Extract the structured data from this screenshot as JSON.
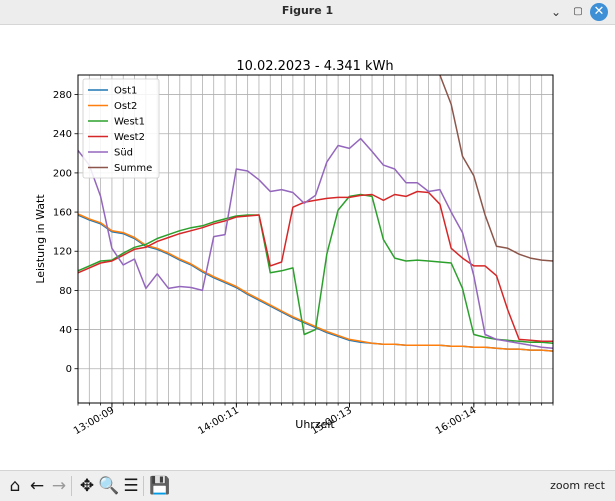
{
  "window": {
    "title": "Figure 1"
  },
  "icons": {
    "minimize": "minimize-icon",
    "maximize": "maximize-icon",
    "close": "close-icon"
  },
  "toolbar": {
    "buttons": [
      {
        "name": "home-icon",
        "glyph": "⌂",
        "enabled": true
      },
      {
        "name": "back-arrow-icon",
        "glyph": "←",
        "enabled": true
      },
      {
        "name": "forward-arrow-icon",
        "glyph": "→",
        "enabled": false
      },
      {
        "name": "pan-icon",
        "glyph": "✥",
        "enabled": true
      },
      {
        "name": "zoom-magnifier-icon",
        "glyph": "🔍",
        "enabled": true
      },
      {
        "name": "configure-subplots-icon",
        "glyph": "☰",
        "enabled": true
      },
      {
        "name": "save-icon",
        "glyph": "💾",
        "enabled": true
      }
    ],
    "mode_text": "zoom rect"
  },
  "chart_data": {
    "type": "line",
    "title": "10.02.2023  -  4.341 kWh",
    "xlabel": "Uhrzeit",
    "ylabel": "Leistung in Watt",
    "ylim": [
      -35,
      300
    ],
    "yticks": [
      0,
      40,
      80,
      120,
      160,
      200,
      240,
      280
    ],
    "x": [
      0,
      1,
      2,
      3,
      4,
      5,
      6,
      7,
      8,
      9,
      10,
      11,
      12,
      13,
      14,
      15,
      16,
      17,
      18,
      19,
      20,
      21,
      22,
      23,
      24,
      25,
      26,
      27,
      28,
      29,
      30,
      31,
      32,
      33,
      34,
      35,
      36,
      37,
      38,
      39,
      40,
      41,
      42
    ],
    "xlim": [
      0,
      42
    ],
    "xticks": [
      {
        "pos": 3,
        "label": "13:00:09"
      },
      {
        "pos": 14,
        "label": "14:00:11"
      },
      {
        "pos": 24,
        "label": "15:00:13"
      },
      {
        "pos": 35,
        "label": "16:00:14"
      }
    ],
    "grid": true,
    "legend": "top-left",
    "series": [
      {
        "name": "Ost1",
        "color": "#1f77b4",
        "values": [
          157,
          152,
          148,
          140,
          138,
          133,
          125,
          122,
          117,
          111,
          106,
          99,
          93,
          88,
          83,
          76,
          70,
          64,
          58,
          52,
          47,
          42,
          37,
          33,
          29,
          27,
          26,
          25,
          25,
          24,
          24,
          24,
          24,
          23,
          23,
          22,
          22,
          21,
          20,
          20,
          19,
          19,
          18
        ]
      },
      {
        "name": "Ost2",
        "color": "#ff7f0e",
        "values": [
          158,
          153,
          149,
          141,
          139,
          134,
          126,
          123,
          118,
          112,
          107,
          100,
          94,
          89,
          84,
          77,
          71,
          65,
          59,
          53,
          48,
          43,
          38,
          34,
          30,
          28,
          26,
          25,
          25,
          24,
          24,
          24,
          24,
          23,
          23,
          22,
          22,
          21,
          20,
          20,
          19,
          19,
          18
        ]
      },
      {
        "name": "West1",
        "color": "#2ca02c",
        "values": [
          100,
          105,
          110,
          111,
          118,
          124,
          127,
          133,
          137,
          141,
          144,
          146,
          150,
          153,
          156,
          157,
          157,
          98,
          100,
          103,
          35,
          40,
          117,
          162,
          176,
          178,
          176,
          132,
          113,
          110,
          111,
          110,
          109,
          108,
          82,
          35,
          32,
          30,
          29,
          28,
          27,
          27,
          26
        ]
      },
      {
        "name": "West2",
        "color": "#d62728",
        "values": [
          98,
          103,
          108,
          110,
          116,
          122,
          124,
          130,
          134,
          138,
          141,
          144,
          148,
          151,
          155,
          156,
          157,
          105,
          109,
          165,
          170,
          172,
          174,
          175,
          175,
          177,
          178,
          172,
          178,
          176,
          181,
          180,
          168,
          123,
          113,
          105,
          105,
          95,
          60,
          30,
          29,
          28,
          28
        ]
      },
      {
        "name": "Süd",
        "color": "#9467bd",
        "values": [
          223,
          208,
          176,
          123,
          106,
          112,
          82,
          97,
          82,
          84,
          83,
          80,
          135,
          137,
          204,
          202,
          193,
          181,
          183,
          180,
          169,
          177,
          211,
          228,
          225,
          235,
          222,
          208,
          204,
          190,
          190,
          181,
          183,
          160,
          139,
          95,
          35,
          30,
          28,
          26,
          24,
          22,
          21
        ]
      },
      {
        "name": "Summe",
        "color": "#8c564b",
        "values": [
          null,
          null,
          null,
          null,
          null,
          null,
          null,
          null,
          null,
          null,
          null,
          null,
          null,
          null,
          null,
          null,
          null,
          null,
          null,
          null,
          null,
          null,
          null,
          null,
          null,
          null,
          null,
          null,
          null,
          null,
          null,
          null,
          300,
          270,
          217,
          197,
          157,
          125,
          123,
          117,
          113,
          111,
          110
        ]
      }
    ]
  }
}
